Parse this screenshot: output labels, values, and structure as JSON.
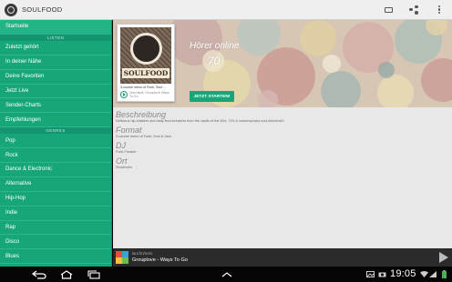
{
  "app": {
    "title": "SOULFOOD"
  },
  "actionbar": {
    "icons": [
      "cast-icon",
      "share-icon",
      "overflow-menu-icon"
    ]
  },
  "sidebar": {
    "items": [
      {
        "label": "Startseite",
        "active": true
      },
      {
        "section": "LISTEN"
      },
      {
        "label": "Zuletzt gehört"
      },
      {
        "label": "In deiner Nähe"
      },
      {
        "label": "Deine Favoriten"
      },
      {
        "label": "Jetzt Live"
      },
      {
        "label": "Sender-Charts"
      },
      {
        "label": "Empfehlungen"
      },
      {
        "section": "GENRES"
      },
      {
        "label": "Pop"
      },
      {
        "label": "Rock"
      },
      {
        "label": "Dance & Electronic"
      },
      {
        "label": "Alternative"
      },
      {
        "label": "Hip-Hop"
      },
      {
        "label": "Indie"
      },
      {
        "label": "Rap"
      },
      {
        "label": "Disco"
      },
      {
        "label": "Blues"
      }
    ]
  },
  "station": {
    "cover_brand": "SOULFOOD",
    "cover_description": "3-course menu of Funk, Soul ...",
    "cover_now_playing": "Jetzt läuft: Grouplove Ways To Go",
    "listeners_label": "Hörer online",
    "listeners_count": "70",
    "start_button": "JETZT STARTEN!"
  },
  "details": {
    "description_heading": "Beschreibung",
    "description_text": "Delicious hip-shakers and tasty floor-breakers from the vaults of the 60's, 70's & contemporary soul-kitchens!!!",
    "format_heading": "Format",
    "format_text": "3-course menu of Funk, Soul & Jazz",
    "dj_heading": "DJ",
    "dj_text": "Funk Freaker",
    "location_heading": "Ort",
    "location_text": "Stockholm"
  },
  "now_playing": {
    "station": "laut.fm/retro",
    "track": "Grouplove - Ways To Go"
  },
  "system": {
    "clock": "19:05"
  },
  "colors": {
    "accent": "#16a67a",
    "accent_dark": "#0f8a64"
  }
}
